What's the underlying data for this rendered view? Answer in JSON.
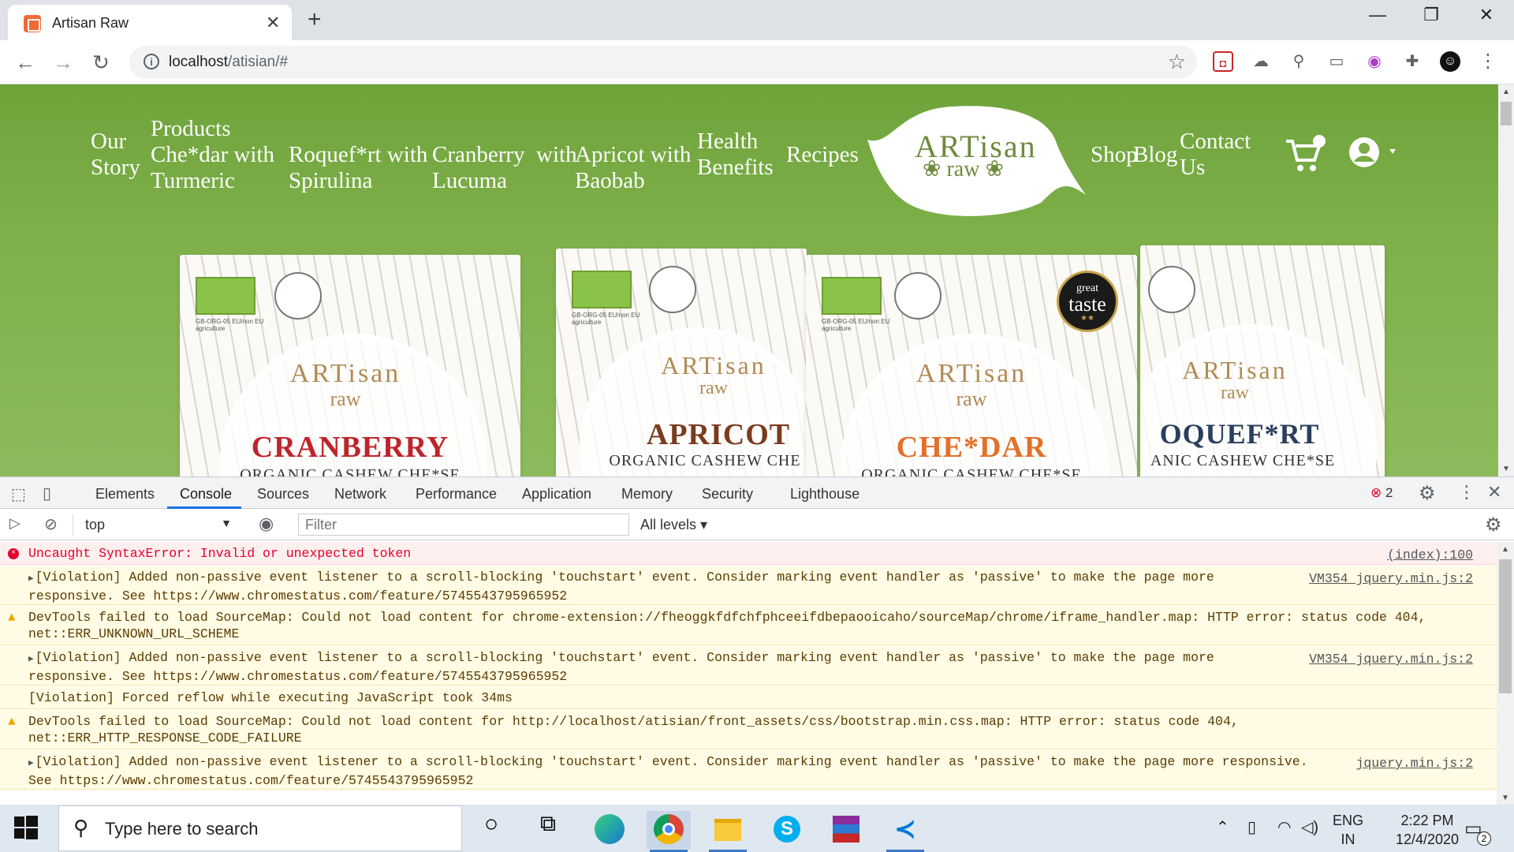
{
  "browser": {
    "tab_title": "Artisan Raw",
    "tab_close": "✕",
    "new_tab": "+",
    "url_host": "localhost",
    "url_path": "/atisian/#",
    "window": {
      "minimize": "—",
      "restore": "❐",
      "close": "✕"
    },
    "icons": {
      "back": "arrow-left-icon",
      "forward": "arrow-right-icon",
      "reload": "reload-icon",
      "star": "star-icon"
    }
  },
  "site": {
    "nav": {
      "our_story": [
        "Our",
        "Story"
      ],
      "products": "Products",
      "chedar": [
        "Che*dar with",
        "Turmeric"
      ],
      "roquefort": [
        "Roquef*rt with",
        "Spirulina"
      ],
      "cranberry": [
        "Cranberry  with",
        "Lucuma"
      ],
      "apricot": [
        "Apricot with",
        "Baobab"
      ],
      "health": [
        "Health",
        "Benefits"
      ],
      "recipes": "Recipes",
      "shop": "Shop",
      "blog": "Blog",
      "contact": [
        "Contact",
        "Us"
      ]
    },
    "logo": {
      "word": "ARTisan",
      "sub": "raw"
    },
    "colors": {
      "header_green": "#7aab45",
      "logo_green": "#6e8b3d"
    },
    "products": [
      {
        "flavor": "CRANBERRY",
        "desc": "ORGANIC CASHEW CHE*SE",
        "color": "#c0242b",
        "brand": "ARTisan",
        "brand_sub": "raw",
        "certification": "GB-ORG-05 EU/non EU agriculture"
      },
      {
        "flavor": "APRICOT",
        "desc": "ORGANIC CASHEW CHE",
        "color": "#7a3b1e",
        "brand": "ARTisan",
        "brand_sub": "raw",
        "certification": "GB-ORG-05 EU/non EU agriculture"
      },
      {
        "flavor": "CHE*DAR",
        "desc": "ORGANIC CASHEW CHE*SE",
        "color": "#e2702a",
        "brand": "ARTisan",
        "brand_sub": "raw",
        "certification": "GB-ORG-05 EU/non EU agriculture"
      },
      {
        "flavor": "OQUEF*RT",
        "desc": "ANIC CASHEW CHE*SE",
        "color": "#2a3f5e",
        "brand": "ARTisan",
        "brand_sub": "raw"
      }
    ],
    "taste_badge": {
      "line1": "great",
      "line2": "taste",
      "stars": "★★"
    }
  },
  "devtools": {
    "tabs": [
      "Elements",
      "Console",
      "Sources",
      "Network",
      "Performance",
      "Application",
      "Memory",
      "Security",
      "Lighthouse"
    ],
    "active_tab": "Console",
    "error_count": "2",
    "context": "top",
    "filter_placeholder": "Filter",
    "levels": "All levels ▾",
    "messages": [
      {
        "type": "err",
        "lines": [
          "Uncaught SyntaxError: Invalid or unexpected token"
        ],
        "source": "(index):100"
      },
      {
        "type": "viol",
        "expand": true,
        "lines": [
          "[Violation] Added non-passive event listener to a scroll-blocking 'touchstart' event. Consider marking event handler as 'passive' to make the page more",
          "responsive. See https://www.chromestatus.com/feature/5745543795965952"
        ],
        "source": "VM354 jquery.min.js:2"
      },
      {
        "type": "warn",
        "lines": [
          "DevTools failed to load SourceMap: Could not load content for chrome-extension://fheoggkfdfchfphceeifdbepaooicaho/sourceMap/chrome/iframe_handler.map: HTTP error: status code 404,",
          "net::ERR_UNKNOWN_URL_SCHEME"
        ],
        "source": ""
      },
      {
        "type": "viol",
        "expand": true,
        "lines": [
          "[Violation] Added non-passive event listener to a scroll-blocking 'touchstart' event. Consider marking event handler as 'passive' to make the page more",
          "responsive. See https://www.chromestatus.com/feature/5745543795965952"
        ],
        "source": "VM354 jquery.min.js:2"
      },
      {
        "type": "viol",
        "expand": false,
        "lines": [
          "[Violation] Forced reflow while executing JavaScript took 34ms"
        ],
        "source": ""
      },
      {
        "type": "warn",
        "lines": [
          "DevTools failed to load SourceMap: Could not load content for http://localhost/atisian/front_assets/css/bootstrap.min.css.map: HTTP error: status code 404,",
          "net::ERR_HTTP_RESPONSE_CODE_FAILURE"
        ],
        "source": ""
      },
      {
        "type": "viol",
        "expand": true,
        "lines": [
          "[Violation] Added non-passive event listener to a scroll-blocking 'touchstart' event. Consider marking event handler as 'passive' to make the page more responsive.",
          "See https://www.chromestatus.com/feature/5745543795965952"
        ],
        "source": "jquery.min.js:2"
      }
    ]
  },
  "taskbar": {
    "search_placeholder": "Type here to search",
    "lang": [
      "ENG",
      "IN"
    ],
    "time": "2:22 PM",
    "date": "12/4/2020",
    "notification_count": "2"
  }
}
